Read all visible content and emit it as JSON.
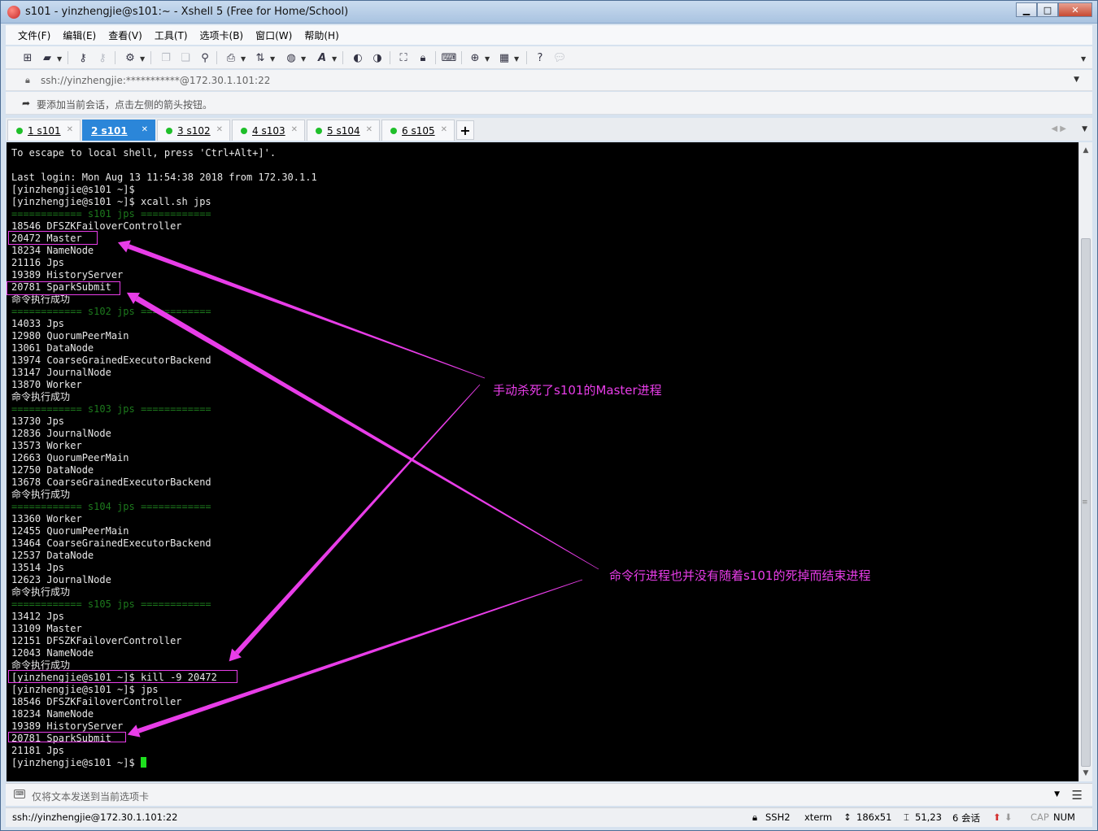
{
  "window": {
    "title": "s101 - yinzhengjie@s101:~ - Xshell 5 (Free for Home/School)",
    "buttons": {
      "minimize": "▁",
      "maximize": "□",
      "close": "✕"
    }
  },
  "menu": [
    "文件(F)",
    "编辑(E)",
    "查看(V)",
    "工具(T)",
    "选项卡(B)",
    "窗口(W)",
    "帮助(H)"
  ],
  "toolbar_icons": [
    "new-session-icon",
    "open-folder-icon",
    "connect-icon",
    "disconnect-icon",
    "properties-icon",
    "copy-icon",
    "paste-icon",
    "find-icon",
    "print-icon",
    "transfer-icon",
    "globe-icon",
    "font-icon",
    "xftp-icon",
    "xmanager-icon",
    "fullscreen-icon",
    "lock-icon",
    "keyboard-icon",
    "add-compose-icon",
    "layout-icon",
    "help-icon",
    "chat-icon"
  ],
  "address": {
    "value": "ssh://yinzhengjie:***********@172.30.1.101:22"
  },
  "hint": {
    "text": "要添加当前会话，点击左侧的箭头按钮。"
  },
  "tabs": [
    {
      "num": "1",
      "name": "s101",
      "active": false
    },
    {
      "num": "2",
      "name": "s101",
      "active": true
    },
    {
      "num": "3",
      "name": "s102",
      "active": false
    },
    {
      "num": "4",
      "name": "s103",
      "active": false
    },
    {
      "num": "5",
      "name": "s104",
      "active": false
    },
    {
      "num": "6",
      "name": "s105",
      "active": false
    }
  ],
  "terminal": {
    "lines": [
      {
        "text": "To escape to local shell, press 'Ctrl+Alt+]'.",
        "kind": "out"
      },
      {
        "text": "",
        "kind": "out"
      },
      {
        "text": "Last login: Mon Aug 13 11:54:38 2018 from 172.30.1.1",
        "kind": "out"
      },
      {
        "text": "[yinzhengjie@s101 ~]$",
        "kind": "out"
      },
      {
        "text": "[yinzhengjie@s101 ~]$ xcall.sh jps",
        "kind": "out"
      },
      {
        "text": "============ s101 jps ============",
        "kind": "sep"
      },
      {
        "text": "18546 DFSZKFailoverController",
        "kind": "out"
      },
      {
        "text": "20472 Master",
        "kind": "out"
      },
      {
        "text": "18234 NameNode",
        "kind": "out"
      },
      {
        "text": "21116 Jps",
        "kind": "out"
      },
      {
        "text": "19389 HistoryServer",
        "kind": "out"
      },
      {
        "text": "20781 SparkSubmit",
        "kind": "out"
      },
      {
        "text": "命令执行成功",
        "kind": "out"
      },
      {
        "text": "============ s102 jps ============",
        "kind": "sep"
      },
      {
        "text": "14033 Jps",
        "kind": "out"
      },
      {
        "text": "12980 QuorumPeerMain",
        "kind": "out"
      },
      {
        "text": "13061 DataNode",
        "kind": "out"
      },
      {
        "text": "13974 CoarseGrainedExecutorBackend",
        "kind": "out"
      },
      {
        "text": "13147 JournalNode",
        "kind": "out"
      },
      {
        "text": "13870 Worker",
        "kind": "out"
      },
      {
        "text": "命令执行成功",
        "kind": "out"
      },
      {
        "text": "============ s103 jps ============",
        "kind": "sep"
      },
      {
        "text": "13730 Jps",
        "kind": "out"
      },
      {
        "text": "12836 JournalNode",
        "kind": "out"
      },
      {
        "text": "13573 Worker",
        "kind": "out"
      },
      {
        "text": "12663 QuorumPeerMain",
        "kind": "out"
      },
      {
        "text": "12750 DataNode",
        "kind": "out"
      },
      {
        "text": "13678 CoarseGrainedExecutorBackend",
        "kind": "out"
      },
      {
        "text": "命令执行成功",
        "kind": "out"
      },
      {
        "text": "============ s104 jps ============",
        "kind": "sep"
      },
      {
        "text": "13360 Worker",
        "kind": "out"
      },
      {
        "text": "12455 QuorumPeerMain",
        "kind": "out"
      },
      {
        "text": "13464 CoarseGrainedExecutorBackend",
        "kind": "out"
      },
      {
        "text": "12537 DataNode",
        "kind": "out"
      },
      {
        "text": "13514 Jps",
        "kind": "out"
      },
      {
        "text": "12623 JournalNode",
        "kind": "out"
      },
      {
        "text": "命令执行成功",
        "kind": "out"
      },
      {
        "text": "============ s105 jps ============",
        "kind": "sep"
      },
      {
        "text": "13412 Jps",
        "kind": "out"
      },
      {
        "text": "13109 Master",
        "kind": "out"
      },
      {
        "text": "12151 DFSZKFailoverController",
        "kind": "out"
      },
      {
        "text": "12043 NameNode",
        "kind": "out"
      },
      {
        "text": "命令执行成功",
        "kind": "out"
      },
      {
        "text": "[yinzhengjie@s101 ~]$ kill -9 20472",
        "kind": "out"
      },
      {
        "text": "[yinzhengjie@s101 ~]$ jps",
        "kind": "out"
      },
      {
        "text": "18546 DFSZKFailoverController",
        "kind": "out"
      },
      {
        "text": "18234 NameNode",
        "kind": "out"
      },
      {
        "text": "19389 HistoryServer",
        "kind": "out"
      },
      {
        "text": "20781 SparkSubmit",
        "kind": "out"
      },
      {
        "text": "21181 Jps",
        "kind": "out"
      },
      {
        "text": "[yinzhengjie@s101 ~]$ ",
        "kind": "prompt"
      }
    ],
    "annotations": [
      "手动杀死了s101的Master进程",
      "命令行进程也并没有随着s101的死掉而结束进程"
    ],
    "annotation_color": "#e83de8",
    "cursor_color": "#1ee01e"
  },
  "compose": {
    "placeholder": "仅将文本发送到当前选项卡"
  },
  "status": {
    "connection": "ssh://yinzhengjie@172.30.1.101:22",
    "protocol": "SSH2",
    "terminal_type": "xterm",
    "size": "186x51",
    "cursor_pos": "51,23",
    "sessions": "6 会话",
    "cap": "CAP",
    "num": "NUM"
  }
}
